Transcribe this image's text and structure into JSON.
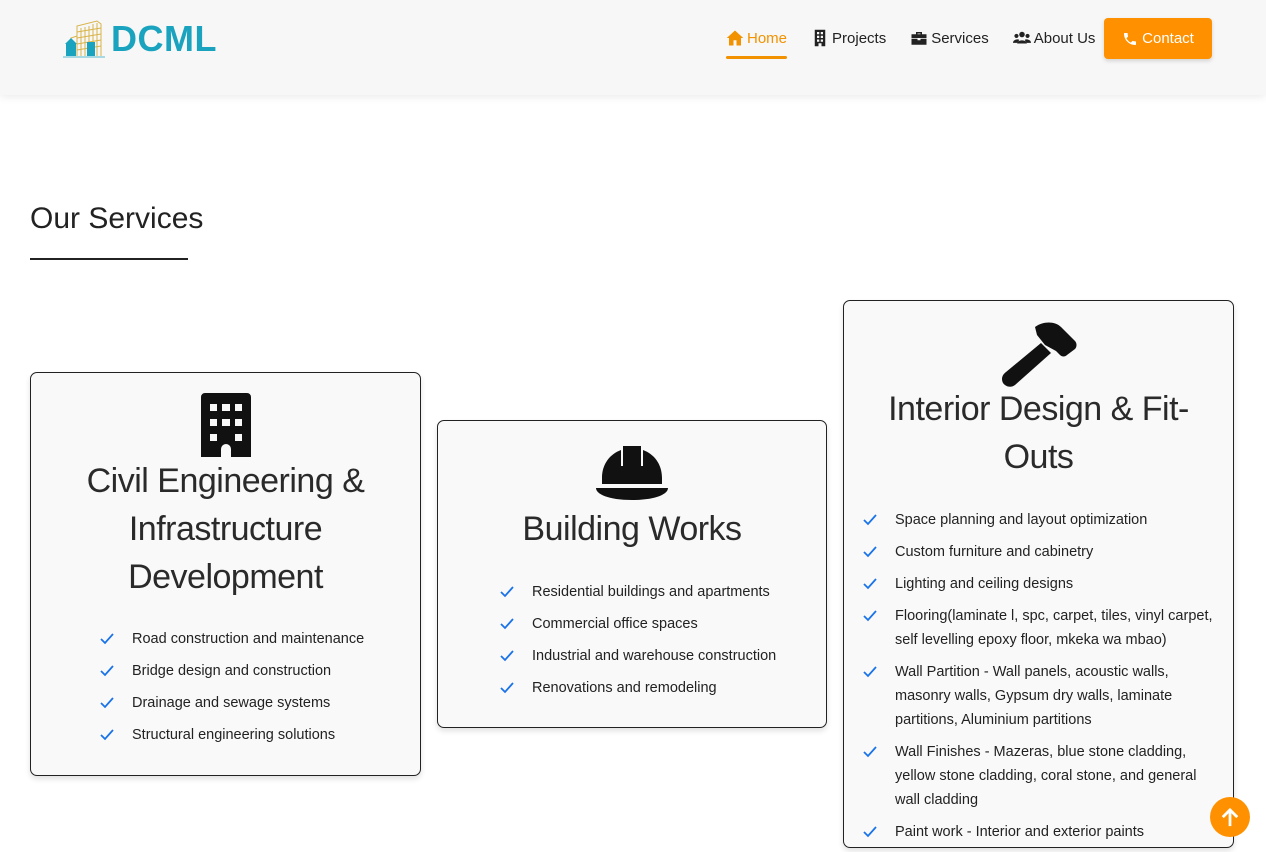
{
  "header": {
    "logo_text": "DCML",
    "nav": [
      {
        "label": "Home",
        "icon": "home-icon",
        "active": true
      },
      {
        "label": "Projects",
        "icon": "building-icon"
      },
      {
        "label": "Services",
        "icon": "toolbox-icon"
      },
      {
        "label": "About Us",
        "icon": "users-icon"
      }
    ],
    "contact_label": "Contact"
  },
  "section": {
    "title": "Our Services"
  },
  "cards": [
    {
      "title_lines": [
        "Civil Engineering &",
        "Infrastructure",
        "Development"
      ],
      "icon": "office-building-icon",
      "items": [
        "Road construction and maintenance",
        "Bridge design and construction",
        "Drainage and sewage systems",
        "Structural engineering solutions"
      ]
    },
    {
      "title_lines": [
        "Building Works"
      ],
      "icon": "hard-hat-icon",
      "items": [
        "Residential buildings and apartments",
        "Commercial office spaces",
        "Industrial and warehouse construction",
        "Renovations and remodeling"
      ]
    },
    {
      "title_lines": [
        "Interior Design & Fit-",
        "Outs"
      ],
      "icon": "hammer-icon",
      "items": [
        "Space planning and layout optimization",
        "Custom furniture and cabinetry",
        "Lighting and ceiling designs",
        "Flooring(laminate l, spc, carpet, tiles, vinyl carpet, self levelling epoxy floor, mkeka wa mbao)",
        "Wall Partition - Wall panels, acoustic walls, masonry walls, Gypsum dry walls, laminate partitions, Aluminium partitions",
        "Wall Finishes - Mazeras, blue stone cladding, yellow stone cladding, coral stone, and general wall cladding",
        "Paint work - Interior and exterior paints"
      ]
    }
  ],
  "colors": {
    "accent": "#ff9100",
    "brand": "#1aa3bf",
    "check": "#1a73e8"
  }
}
